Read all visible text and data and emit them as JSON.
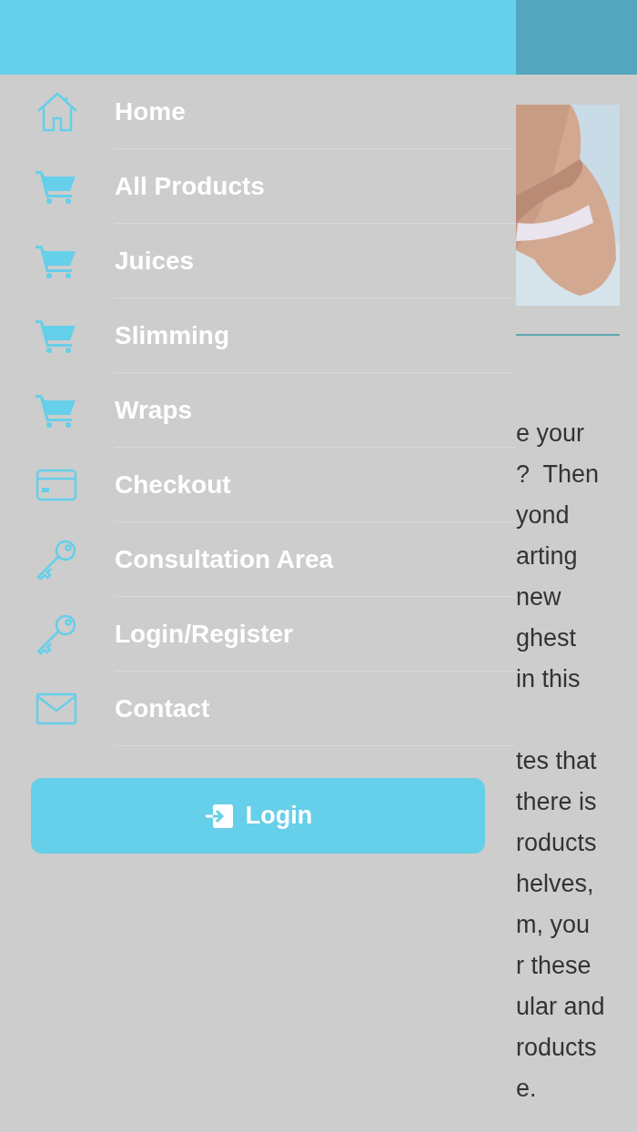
{
  "menu": [
    {
      "kind": "house",
      "label": "Home"
    },
    {
      "kind": "cart",
      "label": "All Products"
    },
    {
      "kind": "cart",
      "label": "Juices"
    },
    {
      "kind": "cart",
      "label": "Slimming"
    },
    {
      "kind": "cart",
      "label": "Wraps"
    },
    {
      "kind": "card",
      "label": "Checkout"
    },
    {
      "kind": "key",
      "label": "Consultation Area"
    },
    {
      "kind": "key",
      "label": "Login/Register"
    },
    {
      "kind": "mail",
      "label": "Contact"
    }
  ],
  "login_button": "Login",
  "background": {
    "paragraphs": [
      [
        "e your",
        "?  Then",
        "yond",
        "arting",
        "new",
        "ghest",
        "in this"
      ],
      [
        "tes that",
        "there is",
        "roducts",
        "helves,",
        "m, you",
        "r these",
        "ular and",
        "roducts",
        "e."
      ]
    ]
  }
}
